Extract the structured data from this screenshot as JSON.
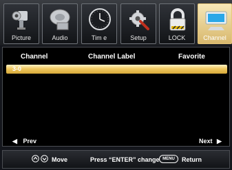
{
  "tabs": [
    {
      "label": "Picture",
      "icon": "camera-icon"
    },
    {
      "label": "Audio",
      "icon": "speaker-icon"
    },
    {
      "label": "Tim e",
      "icon": "clock-icon"
    },
    {
      "label": "Setup",
      "icon": "wrench-gear-icon"
    },
    {
      "label": "LOCK",
      "icon": "lock-icon"
    },
    {
      "label": "Channel",
      "icon": "monitor-icon"
    }
  ],
  "active_tab": "Channel",
  "table": {
    "headers": [
      "Channel",
      "Channel Label",
      "Favorite"
    ],
    "rows": [
      {
        "channel": "3-0",
        "label": "",
        "favorite": "",
        "selected": true
      }
    ]
  },
  "nav": {
    "prev_label": "Prev",
    "next_label": "Next"
  },
  "footer": {
    "move_label": "Move",
    "change_label": "Press “ENTER” change",
    "menu_key": "MENU",
    "return_label": "Return"
  },
  "colors": {
    "highlight": "#f0c860",
    "active_tab": "#e8c77a",
    "background": "#000000"
  }
}
